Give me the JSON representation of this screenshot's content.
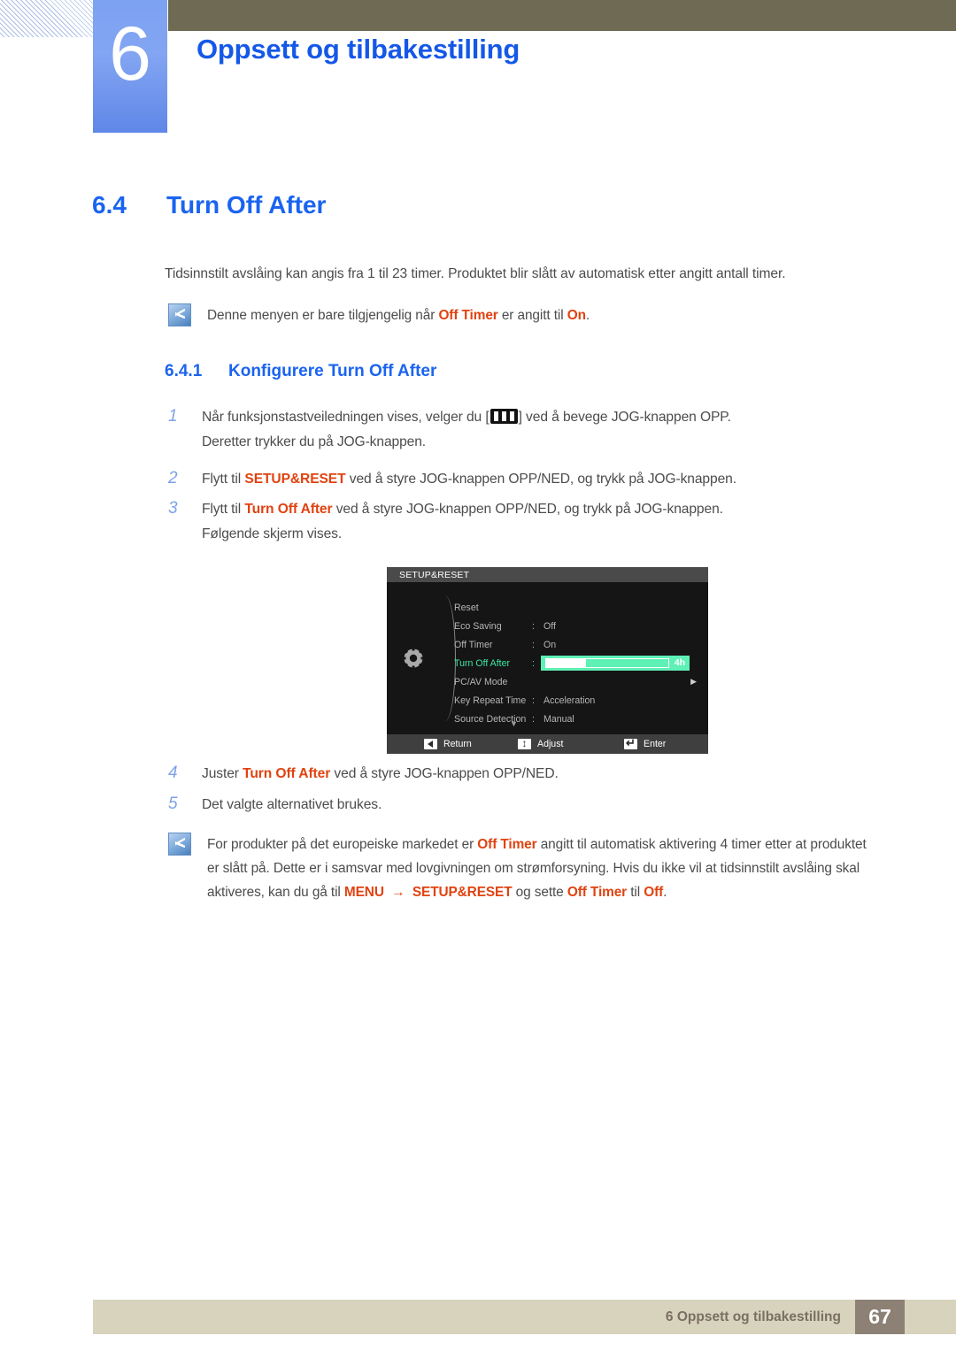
{
  "header": {
    "chapter_number": "6",
    "chapter_title": "Oppsett og tilbakestilling"
  },
  "section": {
    "number": "6.4",
    "title": "Turn Off After",
    "intro": "Tidsinnstilt avslåing kan angis fra 1 til 23 timer. Produktet blir slått av automatisk etter angitt antall timer."
  },
  "note_top": {
    "icon": "note-pencil-icon",
    "text_1": "Denne menyen er bare tilgjengelig når ",
    "hl_1": "Off Timer",
    "text_2": " er angitt til ",
    "hl_2": "On",
    "text_3": "."
  },
  "subsection": {
    "number": "6.4.1",
    "title": "Konfigurere Turn Off After"
  },
  "steps": [
    {
      "num": "1",
      "t1": "Når funksjonstastveiledningen vises, velger du [",
      "icon": "menu-bars-icon",
      "t2": "] ved å bevege JOG-knappen OPP.",
      "line2": "Deretter trykker du på JOG-knappen."
    },
    {
      "num": "2",
      "t1": "Flytt til ",
      "hl": "SETUP&RESET",
      "t2": " ved å styre JOG-knappen OPP/NED, og trykk på JOG-knappen."
    },
    {
      "num": "3",
      "t1": "Flytt til ",
      "hl": "Turn Off After",
      "t2": " ved å styre JOG-knappen OPP/NED, og trykk på JOG-knappen.",
      "line2": "Følgende skjerm vises."
    },
    {
      "num": "4",
      "t1": "Juster ",
      "hl": "Turn Off After",
      "t2": " ved å styre JOG-knappen OPP/NED."
    },
    {
      "num": "5",
      "t1": "Det valgte alternativet brukes."
    }
  ],
  "osd": {
    "title": "SETUP&RESET",
    "gear_icon": "gear-icon",
    "scroll_down_icon": "chevron-down-icon",
    "rows": [
      {
        "label": "Reset",
        "colon": "",
        "value": "",
        "selected": false,
        "type": "plain"
      },
      {
        "label": "Eco Saving",
        "colon": ":",
        "value": "Off",
        "selected": false,
        "type": "plain"
      },
      {
        "label": "Off Timer",
        "colon": ":",
        "value": "On",
        "selected": false,
        "type": "plain"
      },
      {
        "label": "Turn Off After",
        "colon": ":",
        "value": "4h",
        "selected": true,
        "type": "slider",
        "fill_percent": 33
      },
      {
        "label": "PC/AV Mode",
        "colon": "",
        "value": "",
        "selected": false,
        "type": "submenu",
        "arrow": "▶"
      },
      {
        "label": "Key Repeat Time",
        "colon": ":",
        "value": "Acceleration",
        "selected": false,
        "type": "plain"
      },
      {
        "label": "Source Detection",
        "colon": ":",
        "value": "Manual",
        "selected": false,
        "type": "plain"
      }
    ],
    "footer": [
      {
        "icon": "left-arrow-key-icon",
        "label": "Return"
      },
      {
        "icon": "up-down-arrow-key-icon",
        "label": "Adjust"
      },
      {
        "icon": "enter-key-icon",
        "label": "Enter"
      }
    ],
    "colors": {
      "selected_green": "#3ee6a4",
      "slider_green": "#5ff0b6",
      "background": "#151515"
    }
  },
  "note_bottom": {
    "icon": "note-pencil-icon",
    "t1": "For produkter på det europeiske markedet er ",
    "hl1": "Off Timer",
    "t2": " angitt til automatisk aktivering 4 timer etter at produktet er slått på. Dette er i samsvar med lovgivningen om strømforsyning. Hvis du ikke vil at tidsinnstilt avslåing skal aktiveres, kan du gå til ",
    "hl2": "MENU",
    "arrow": "→",
    "hl3": "SETUP&RESET",
    "t3": " og sette ",
    "hl4": "Off Timer",
    "t4": " til ",
    "hl5": "Off",
    "t5": "."
  },
  "footer": {
    "text": "6 Oppsett og tilbakestilling",
    "page": "67"
  },
  "colors": {
    "accent_blue": "#1a64f0",
    "highlight_orange": "#e1420f",
    "olive": "#6e6a53",
    "footer_beige": "#d8d3bd",
    "footer_brown": "#8d8075"
  }
}
